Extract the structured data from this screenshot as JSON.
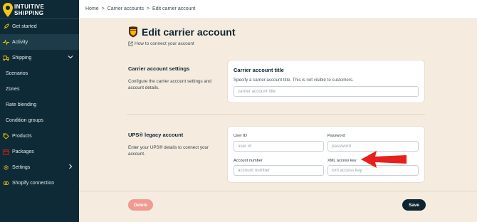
{
  "brand": {
    "line1": "INTUITIVE",
    "line2": "SHIPPING"
  },
  "colors": {
    "sidebar": "#0e2a36",
    "accent_yellow": "#f5c518",
    "delete": "#f29a91",
    "save": "#0f2430",
    "arrow": "#e8201c",
    "background": "#f5ecdf"
  },
  "sidebar": {
    "items": [
      {
        "label": "Get started",
        "icon": "rocket-icon"
      },
      {
        "label": "Activity",
        "icon": "activity-icon"
      },
      {
        "label": "Shipping",
        "icon": "truck-icon"
      },
      {
        "label": "Scenarios"
      },
      {
        "label": "Zones"
      },
      {
        "label": "Rate blending"
      },
      {
        "label": "Condition groups"
      },
      {
        "label": "Products",
        "icon": "tag-icon"
      },
      {
        "label": "Packages",
        "icon": "package-icon"
      },
      {
        "label": "Settings",
        "icon": "gear-icon"
      },
      {
        "label": "Shopify connection",
        "icon": "link-icon"
      }
    ]
  },
  "breadcrumb": {
    "home": "Home",
    "sep1": ">",
    "carriers": "Carrier accounts",
    "sep2": ">",
    "current": "Edit carrier account"
  },
  "page": {
    "title": "Edit carrier account",
    "help_link": "How to connect your account"
  },
  "settings_section": {
    "title": "Carrier account settings",
    "description": "Configure the carrier account settings and account details.",
    "card_title": "Carrier account title",
    "card_help": "Specify a carrier account title. This is not visible to customers.",
    "title_placeholder": "carrier account title"
  },
  "ups_section": {
    "title": "UPS® legacy account",
    "description": "Enter your UPS® details to connect your account.",
    "user_id_label": "User ID",
    "user_id_placeholder": "user id",
    "password_label": "Password",
    "password_placeholder": "password",
    "account_number_label": "Account number",
    "account_number_placeholder": "account number",
    "xml_key_label": "XML access key",
    "xml_key_placeholder": "xml access key"
  },
  "footer": {
    "delete_label": "Delete",
    "save_label": "Save"
  }
}
